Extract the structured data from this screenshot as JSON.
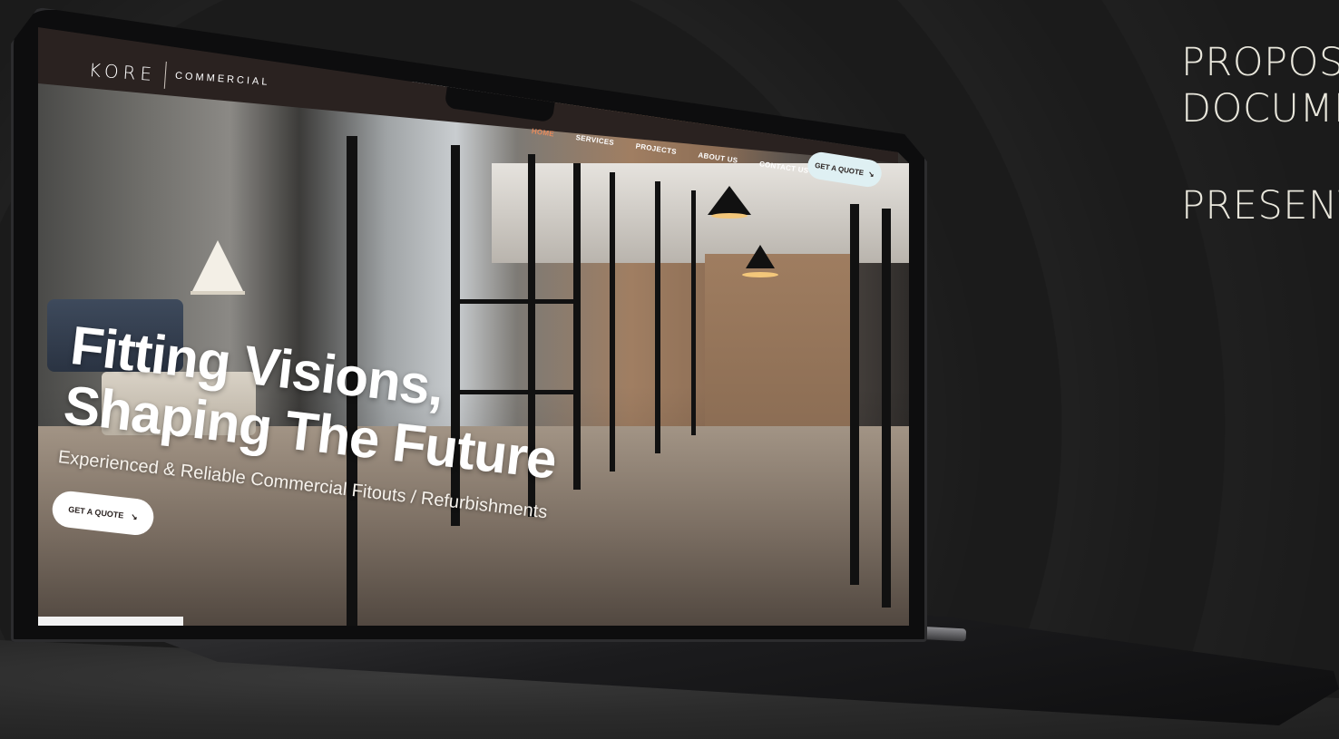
{
  "side_text": {
    "line1": "PROPOSAL",
    "line2": "DOCUMENT",
    "line3": "PRESENTATION"
  },
  "site": {
    "logo_main": "KORE",
    "logo_sub": "COMMERCIAL",
    "nav": {
      "items": [
        {
          "label": "HOME",
          "active": true
        },
        {
          "label": "SERVICES",
          "active": false
        },
        {
          "label": "PROJECTS",
          "active": false
        },
        {
          "label": "ABOUT US",
          "active": false
        },
        {
          "label": "CONTACT US",
          "active": false
        }
      ],
      "cta_label": "GET A QUOTE",
      "cta_icon": "arrow-down-right-icon"
    },
    "hero": {
      "title_line1": "Fitting Visions,",
      "title_line2": "Shaping The Future",
      "subtitle": "Experienced & Reliable Commercial Fitouts / Refurbishments",
      "cta_label": "GET A QUOTE",
      "cta_icon": "arrow-down-right-icon"
    }
  },
  "colors": {
    "nav_bg": "#2a2220",
    "nav_active": "#e58a5c",
    "nav_cta_bg": "#dff0f3",
    "page_bg": "#1b1b1b",
    "side_text": "#e9e7dc"
  }
}
